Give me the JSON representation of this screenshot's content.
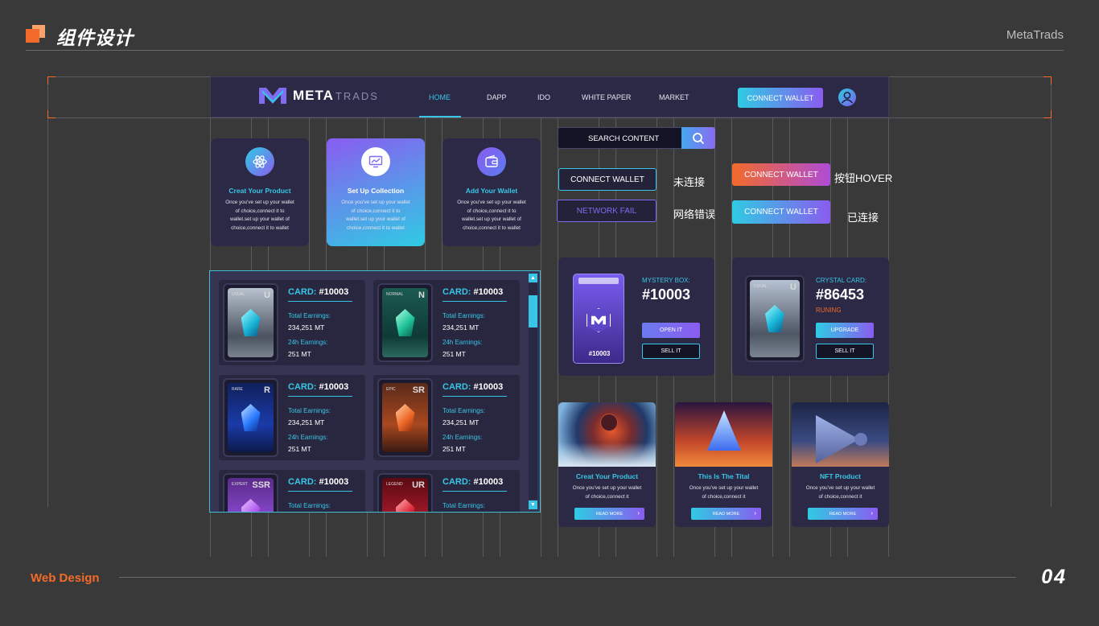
{
  "header": {
    "title": "组件设计",
    "brand": "MetaTrads"
  },
  "footer": {
    "left": "Web Design",
    "page": "04"
  },
  "nav": {
    "logo_bold": "META",
    "logo_thin": "TRADS",
    "items": [
      "HOME",
      "DAPP",
      "IDO",
      "WHITE PAPER",
      "MARKET"
    ],
    "connect": "CONNECT WALLET"
  },
  "features": [
    {
      "title": "Creat Your Product",
      "text": [
        "Once you've set up your wallet",
        "of choice,connect it to",
        "wallet.set up your wallet of",
        "choice,connect it to wallet"
      ]
    },
    {
      "title": "Set Up Collection",
      "text": [
        "Once you've set up your wallet",
        "of choice,connect it to",
        "wallet.set up your wallet of",
        "choice,connect it to wallet"
      ]
    },
    {
      "title": "Add Your Wallet",
      "text": [
        "Once you've set up your wallet",
        "of choice,connect it to",
        "wallet.set up your wallet of",
        "choice,connect it to wallet"
      ]
    }
  ],
  "list_cards": [
    {
      "card_label": "CARD:",
      "card_id": "#10003",
      "rank": "USUAL",
      "letter": "U",
      "l1": "Total Earnings:",
      "v1": "234,251 MT",
      "l2": "24h Earnings:",
      "v2": "251 MT"
    },
    {
      "card_label": "CARD:",
      "card_id": "#10003",
      "rank": "NORMAL",
      "letter": "N",
      "l1": "Total Earnings:",
      "v1": "234,251 MT",
      "l2": "24h Earnings:",
      "v2": "251 MT"
    },
    {
      "card_label": "CARD:",
      "card_id": "#10003",
      "rank": "RARE",
      "letter": "R",
      "l1": "Total Earnings:",
      "v1": "234,251 MT",
      "l2": "24h Earnings:",
      "v2": "251 MT"
    },
    {
      "card_label": "CARD:",
      "card_id": "#10003",
      "rank": "EPIC",
      "letter": "SR",
      "l1": "Total Earnings:",
      "v1": "234,251 MT",
      "l2": "24h Earnings:",
      "v2": "251 MT"
    },
    {
      "card_label": "CARD:",
      "card_id": "#10003",
      "rank": "EXPERT",
      "letter": "SSR",
      "l1": "Total Earnings:",
      "v1": "",
      "l2": "",
      "v2": ""
    },
    {
      "card_label": "CARD:",
      "card_id": "#10003",
      "rank": "LEGEND",
      "letter": "UR",
      "l1": "Total Earnings:",
      "v1": "",
      "l2": "",
      "v2": ""
    }
  ],
  "search": {
    "placeholder": "SEARCH CONTENT"
  },
  "buttons": {
    "connect_outline": "CONNECT WALLET",
    "state_unconnected": "未连接",
    "network_fail": "NETWORK FAIL",
    "state_network": "网络错误",
    "connect_hover": "CONNECT WALLET",
    "state_hover": "按钮HOVER",
    "connect_done": "CONNECT WALLET",
    "state_done": "已连接"
  },
  "mystery": {
    "label": "MYSTERY BOX:",
    "id": "#10003",
    "box_id": "#10003",
    "open": "OPEN IT",
    "sell": "SELL IT"
  },
  "crystal": {
    "label": "CRYSTAL CARD:",
    "id": "#86453",
    "status": "RUNING",
    "upgrade": "UPGRADE",
    "sell": "SELL IT",
    "rank": "USUAL",
    "letter": "U"
  },
  "image_cards": [
    {
      "title": "Creat Your Product",
      "text": [
        "Once you've set up your wallet",
        "of choice,connect it"
      ],
      "button": "READ MORE"
    },
    {
      "title": "This Is The Tital",
      "text": [
        "Once you've set up your wallet",
        "of choice,connect it"
      ],
      "button": "READ MORE"
    },
    {
      "title": "NFT Product",
      "text": [
        "Once you've set up your wallet",
        "of choice,connect it"
      ],
      "button": "READ MORE"
    }
  ],
  "colors": {
    "accent": "#39c6e6",
    "orange": "#f26b2a",
    "purple": "#8a5cf0",
    "panel": "#2b2945"
  }
}
